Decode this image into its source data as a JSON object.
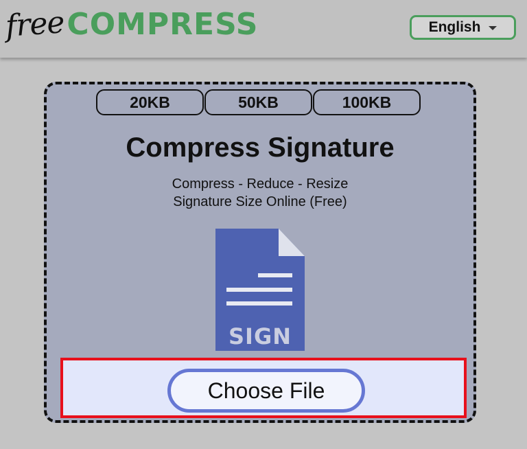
{
  "header": {
    "logo_free": "free",
    "logo_compress": "COMPRESS",
    "language": "English",
    "language_icon": "chevron-down-icon"
  },
  "card": {
    "size_presets": [
      {
        "label": "20KB"
      },
      {
        "label": "50KB"
      },
      {
        "label": "100KB"
      }
    ],
    "title": "Compress Signature",
    "subtitle_line1": "Compress - Reduce - Resize",
    "subtitle_line2": "Signature Size Online (Free)",
    "file_icon": "signature-file-icon",
    "file_icon_label": "SIGN",
    "choose_file_label": "Choose File"
  },
  "colors": {
    "brand_green": "#4a9e5c",
    "card_bg": "#a5aabd",
    "file_icon_blue": "#4e62b1",
    "button_border": "#6677d3",
    "highlight_red": "#e8101c"
  }
}
